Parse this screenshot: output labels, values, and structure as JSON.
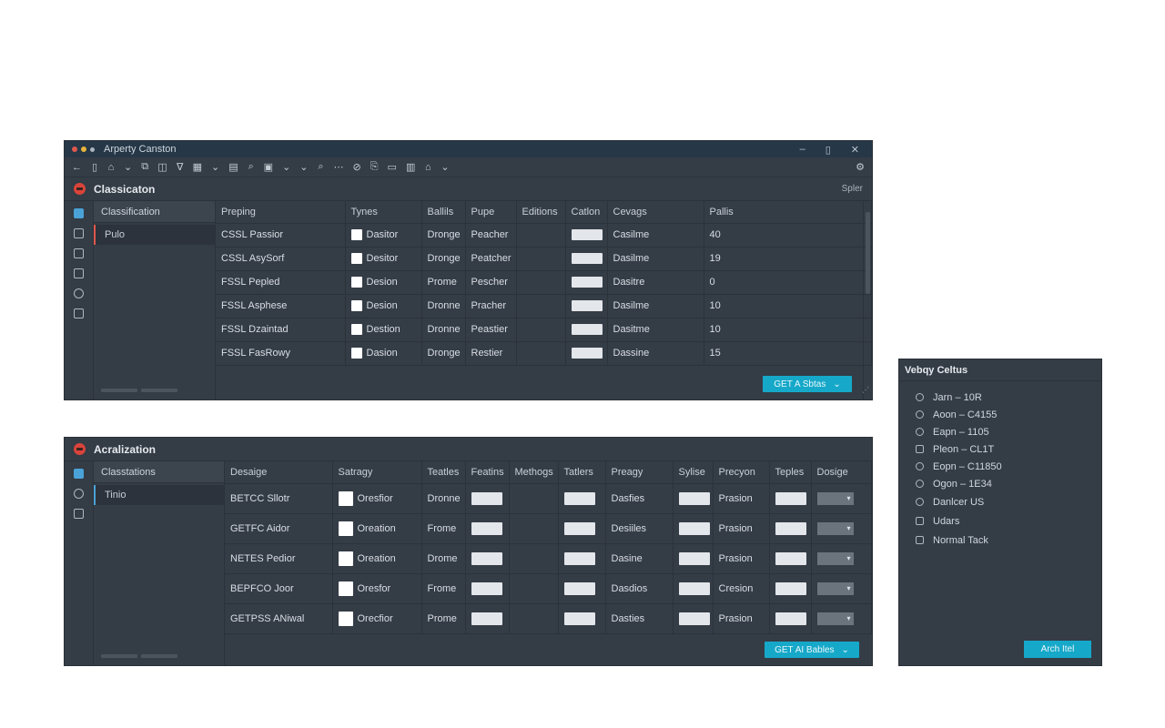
{
  "window1": {
    "title": "Arperty Canston",
    "section_title": "Classicaton",
    "section_right": "Spler",
    "tree_header": "Classification",
    "tree_item": "Pulo",
    "columns": [
      "Preping",
      "Tynes",
      "Ballils",
      "Pupe",
      "Editions",
      "Catlon",
      "Cevags",
      "Pallis"
    ],
    "rows": [
      {
        "name": "CSSL Passior",
        "type": "Dasitor",
        "c3": "Dronge",
        "c4": "Peacher",
        "c7": "Casilme",
        "c8": "40"
      },
      {
        "name": "CSSL AsySorf",
        "type": "Desitor",
        "c3": "Dronge",
        "c4": "Peatcher",
        "c7": "Dasilme",
        "c8": "19"
      },
      {
        "name": "FSSL Pepled",
        "type": "Desion",
        "c3": "Prome",
        "c4": "Pescher",
        "c7": "Dasitre",
        "c8": "0"
      },
      {
        "name": "FSSL Asphese",
        "type": "Desion",
        "c3": "Dronne",
        "c4": "Pracher",
        "c7": "Dasilme",
        "c8": "10"
      },
      {
        "name": "FSSL Dzaintad",
        "type": "Destion",
        "c3": "Dronne",
        "c4": "Peastier",
        "c7": "Dasitme",
        "c8": "10"
      },
      {
        "name": "FSSL FasRowy",
        "type": "Dasion",
        "c3": "Dronge",
        "c4": "Restier",
        "c7": "Dassine",
        "c8": "15"
      }
    ],
    "action_button": "GET A Sbtas"
  },
  "window2": {
    "section_title": "Acralization",
    "tree_header": "Classtations",
    "tree_item": "Tinio",
    "columns": [
      "Desaige",
      "Satragy",
      "Teatles",
      "Featins",
      "Methogs",
      "Tatlers",
      "Preagy",
      "Sylise",
      "Precyon",
      "Teples",
      "Dosige"
    ],
    "rows": [
      {
        "name": "BETCC Sllotr",
        "type": "Oresfior",
        "c3": "Dronne",
        "c6": "Dasfies",
        "c8": "Prasion"
      },
      {
        "name": "GETFC Aidor",
        "type": "Oreation",
        "c3": "Frome",
        "c6": "Desiiles",
        "c8": "Prasion"
      },
      {
        "name": "NETES Pedior",
        "type": "Oreation",
        "c3": "Drome",
        "c6": "Dasine",
        "c8": "Prasion"
      },
      {
        "name": "BEPFCO Joor",
        "type": "Oresfor",
        "c3": "Frome",
        "c6": "Dasdios",
        "c8": "Cresion"
      },
      {
        "name": "GETPSS ANiwal",
        "type": "Orecfior",
        "c3": "Prome",
        "c6": "Dasties",
        "c8": "Prasion"
      }
    ],
    "action_button": "GET AI Bables"
  },
  "side_panel": {
    "title": "Vebqy Celtus",
    "items": [
      {
        "label": "Jarn – 10R",
        "icon": "circle-icon"
      },
      {
        "label": "Aoon – C4155",
        "icon": "link-icon"
      },
      {
        "label": "Eapn – 1105",
        "icon": "share-icon"
      },
      {
        "label": "Pleon – CL1T",
        "icon": "document-icon"
      },
      {
        "label": "Eopn – C11850",
        "icon": "refresh-icon"
      },
      {
        "label": "Ogon – 1E34",
        "icon": "clock-icon"
      },
      {
        "label": "Danlcer US",
        "icon": "search-icon"
      },
      {
        "label": "Udars",
        "icon": "list-icon"
      },
      {
        "label": "Normal Tack",
        "icon": "edit-icon"
      }
    ],
    "button": "Arch Itel"
  },
  "colors": {
    "accent": "#16a8c9",
    "window_bg": "#343c46",
    "titlebar": "#263848",
    "brand_red": "#d8443a"
  }
}
